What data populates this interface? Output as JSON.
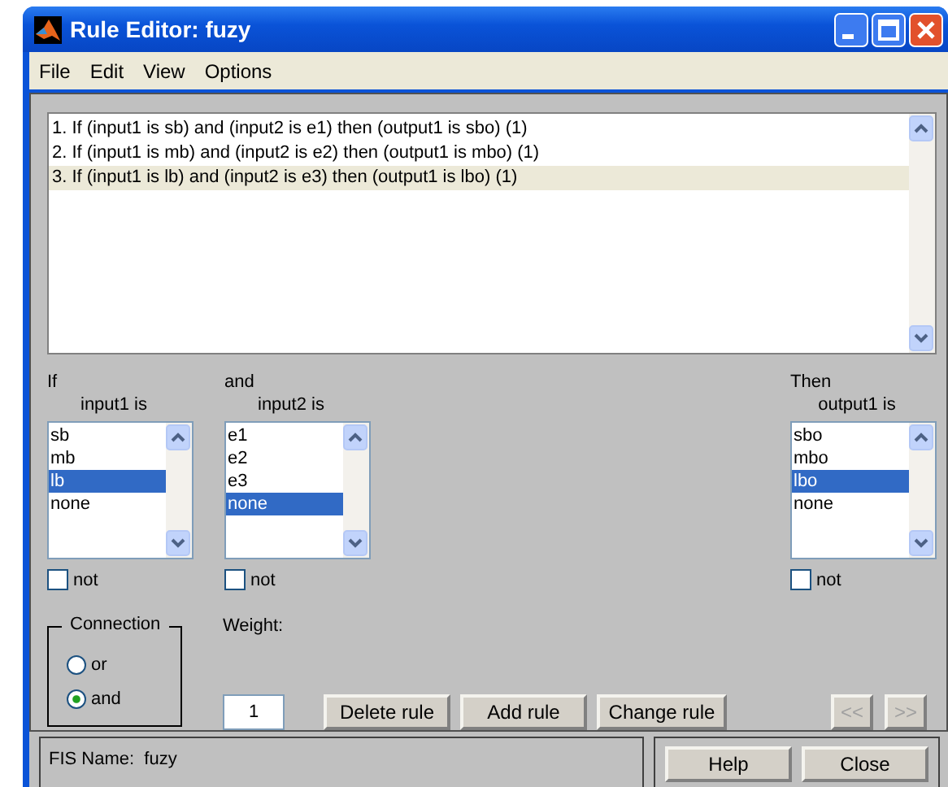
{
  "window": {
    "title": "Rule Editor: fuzy"
  },
  "menu": [
    "File",
    "Edit",
    "View",
    "Options"
  ],
  "rules": [
    {
      "text": "1. If (input1 is sb) and (input2 is e1) then (output1 is sbo) (1)",
      "selected": false
    },
    {
      "text": "2. If (input1 is mb) and (input2 is e2) then (output1 is mbo) (1)",
      "selected": false
    },
    {
      "text": "3. If (input1 is lb) and (input2 is e3) then (output1 is lbo) (1)",
      "selected": true
    }
  ],
  "variables": [
    {
      "header": "If",
      "label": "input1 is",
      "not_label": "not",
      "not_checked": false,
      "options": [
        {
          "text": "sb",
          "selected": false
        },
        {
          "text": "mb",
          "selected": false
        },
        {
          "text": "lb",
          "selected": true
        },
        {
          "text": "none",
          "selected": false
        }
      ]
    },
    {
      "header": "and",
      "label": "input2 is",
      "not_label": "not",
      "not_checked": false,
      "options": [
        {
          "text": "e1",
          "selected": false
        },
        {
          "text": "e2",
          "selected": false
        },
        {
          "text": "e3",
          "selected": false
        },
        {
          "text": "none",
          "selected": true
        }
      ]
    },
    {
      "header": "Then",
      "label": "output1 is",
      "not_label": "not",
      "not_checked": false,
      "options": [
        {
          "text": "sbo",
          "selected": false
        },
        {
          "text": "mbo",
          "selected": false
        },
        {
          "text": "lbo",
          "selected": true
        },
        {
          "text": "none",
          "selected": false
        }
      ]
    }
  ],
  "connection": {
    "label": "Connection",
    "options": [
      {
        "label": "or",
        "selected": false
      },
      {
        "label": "and",
        "selected": true
      }
    ]
  },
  "weight": {
    "label": "Weight:",
    "value": "1"
  },
  "buttons": [
    {
      "label": "Delete rule",
      "disabled": false
    },
    {
      "label": "Add rule",
      "disabled": false
    },
    {
      "label": "Change rule",
      "disabled": false
    },
    {
      "label": "<<",
      "disabled": true
    },
    {
      "label": ">>",
      "disabled": true
    }
  ],
  "fis_name": "FIS Name:  fuzy",
  "footer_buttons": [
    {
      "label": "Help",
      "disabled": false
    },
    {
      "label": "Close",
      "disabled": false
    }
  ]
}
